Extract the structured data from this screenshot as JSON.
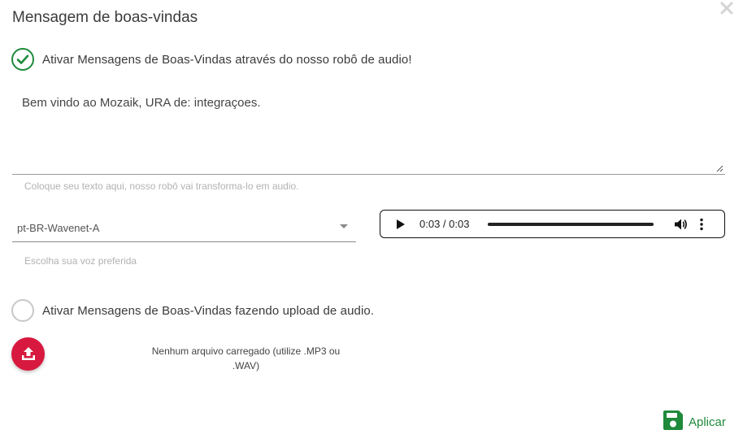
{
  "dialog": {
    "title": "Mensagem de boas-vindas",
    "close_icon": "close-icon"
  },
  "tts_option": {
    "label": "Ativar Mensagens de Boas-Vindas através do nosso robô de audio!",
    "checked": true
  },
  "message": {
    "value": "Bem vindo ao Mozaik, URA de: integraçoes.",
    "hint": "Coloque seu texto aqui, nosso robô vai transforma-lo em audio."
  },
  "voice": {
    "selected": "pt-BR-Wavenet-A",
    "hint": "Escolha sua voz preferida"
  },
  "audio_player": {
    "time": "0:03 / 0:03",
    "progress": 1.0
  },
  "upload_option": {
    "label": "Ativar Mensagens de Boas-Vindas fazendo upload de audio.",
    "checked": false
  },
  "upload": {
    "status": "Nenhum arquivo carregado (utilize .MP3 ou .WAV)",
    "icon": "upload-icon"
  },
  "apply_button": {
    "label": "Aplicar",
    "icon": "save-icon"
  },
  "colors": {
    "accent_green": "#1f8a3b",
    "upload_red": "#d8193f"
  }
}
